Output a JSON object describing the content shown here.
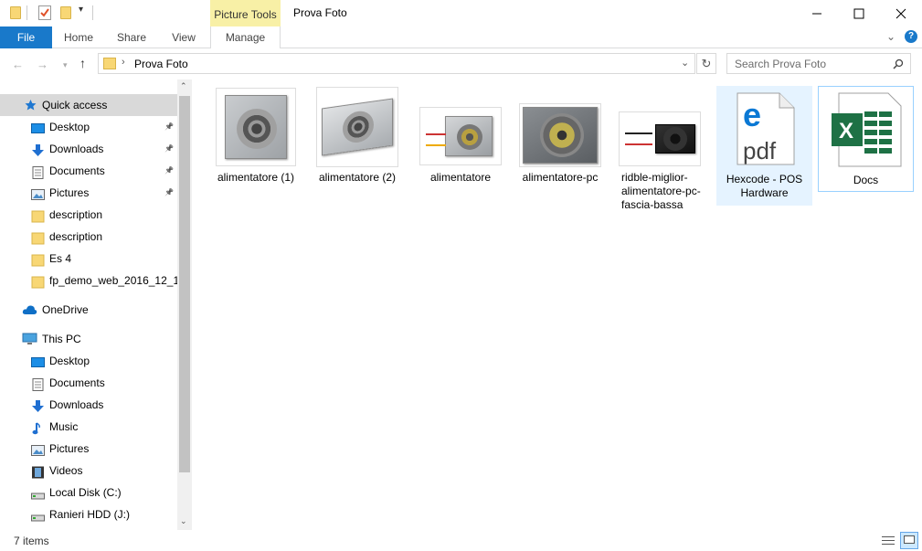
{
  "window": {
    "context_tab": "Picture Tools",
    "title": "Prova Foto"
  },
  "ribbon": {
    "tabs": [
      "File",
      "Home",
      "Share",
      "View",
      "Manage"
    ]
  },
  "address": {
    "path": "Prova Foto",
    "search_placeholder": "Search Prova Foto"
  },
  "nav": {
    "quick_access": "Quick access",
    "quick_items": [
      {
        "label": "Desktop",
        "icon": "desktop-icon",
        "pinned": true
      },
      {
        "label": "Downloads",
        "icon": "download-arrow-icon",
        "pinned": true
      },
      {
        "label": "Documents",
        "icon": "document-icon",
        "pinned": true
      },
      {
        "label": "Pictures",
        "icon": "pictures-icon",
        "pinned": true
      },
      {
        "label": "description",
        "icon": "folder-icon"
      },
      {
        "label": "description",
        "icon": "folder-icon"
      },
      {
        "label": "Es 4",
        "icon": "folder-icon"
      },
      {
        "label": "fp_demo_web_2016_12_13_",
        "icon": "folder-icon"
      }
    ],
    "onedrive": "OneDrive",
    "this_pc": "This PC",
    "pc_items": [
      {
        "label": "Desktop",
        "icon": "desktop-icon"
      },
      {
        "label": "Documents",
        "icon": "document-icon"
      },
      {
        "label": "Downloads",
        "icon": "download-arrow-icon"
      },
      {
        "label": "Music",
        "icon": "music-note-icon"
      },
      {
        "label": "Pictures",
        "icon": "pictures-icon"
      },
      {
        "label": "Videos",
        "icon": "film-icon"
      },
      {
        "label": "Local Disk (C:)",
        "icon": "drive-icon"
      },
      {
        "label": "Ranieri HDD (J:)",
        "icon": "drive-icon"
      }
    ]
  },
  "files": [
    {
      "name": "alimentatore (1)",
      "kind": "image"
    },
    {
      "name": "alimentatore (2)",
      "kind": "image"
    },
    {
      "name": "alimentatore",
      "kind": "image"
    },
    {
      "name": "alimentatore-pc",
      "kind": "image"
    },
    {
      "name": "ridble-miglior-alimentatore-pc-fascia-bassa",
      "kind": "image"
    },
    {
      "name": "Hexcode - POS Hardware",
      "kind": "pdf"
    },
    {
      "name": "Docs",
      "kind": "excel"
    }
  ],
  "status": {
    "item_count": "7 items"
  },
  "colors": {
    "accent": "#1979ca",
    "context_tab": "#f8f0a6",
    "selection": "#cce8ff",
    "hover": "#e5f3ff",
    "excel": "#1e7145",
    "edge": "#0078d7",
    "folder": "#f8d775"
  }
}
